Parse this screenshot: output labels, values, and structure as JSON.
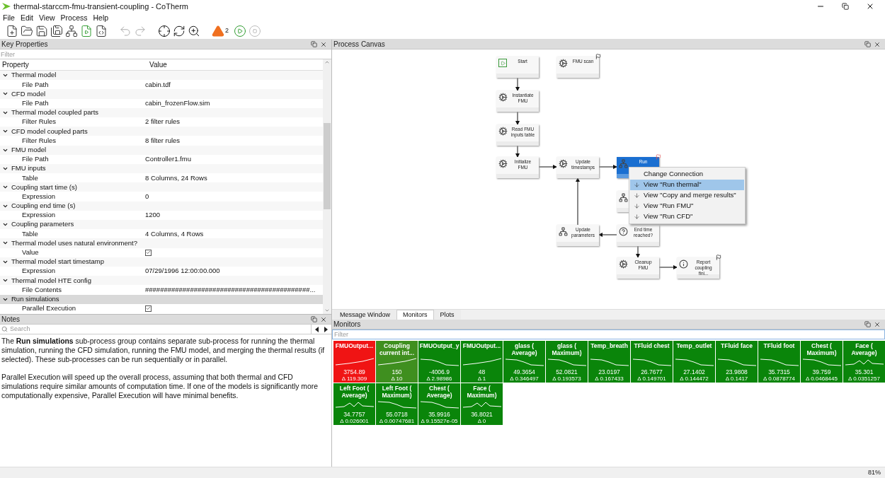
{
  "window": {
    "title": "thermal-starccm-fmu-transient-coupling - CoTherm"
  },
  "menu": [
    "File",
    "Edit",
    "View",
    "Process",
    "Help"
  ],
  "toolbar": {
    "warning_count": "2"
  },
  "key_properties": {
    "title": "Key Properties",
    "filter_placeholder": "Filter",
    "columns": [
      "Property",
      "Value"
    ],
    "groups": [
      {
        "name": "Thermal model",
        "expanded": true,
        "selected": false,
        "children": [
          {
            "name": "File Path",
            "kind": "text",
            "value": "cabin.tdf"
          }
        ]
      },
      {
        "name": "CFD model",
        "expanded": true,
        "selected": false,
        "children": [
          {
            "name": "File Path",
            "kind": "text",
            "value": "cabin_frozenFlow.sim"
          }
        ]
      },
      {
        "name": "Thermal model coupled parts",
        "expanded": true,
        "selected": false,
        "children": [
          {
            "name": "Filter Rules",
            "kind": "text",
            "value": "2 filter rules"
          }
        ]
      },
      {
        "name": "CFD model coupled parts",
        "expanded": true,
        "selected": false,
        "children": [
          {
            "name": "Filter Rules",
            "kind": "text",
            "value": "8 filter rules"
          }
        ]
      },
      {
        "name": "FMU model",
        "expanded": true,
        "selected": false,
        "children": [
          {
            "name": "File Path",
            "kind": "text",
            "value": "Controller1.fmu"
          }
        ]
      },
      {
        "name": "FMU inputs",
        "expanded": true,
        "selected": false,
        "children": [
          {
            "name": "Table",
            "kind": "text",
            "value": "8 Columns, 24 Rows"
          }
        ]
      },
      {
        "name": "Coupling start time (s)",
        "expanded": true,
        "selected": false,
        "children": [
          {
            "name": "Expression",
            "kind": "text",
            "value": "0"
          }
        ]
      },
      {
        "name": "Coupling end time (s)",
        "expanded": true,
        "selected": false,
        "children": [
          {
            "name": "Expression",
            "kind": "text",
            "value": "1200"
          }
        ]
      },
      {
        "name": "Coupling parameters",
        "expanded": true,
        "selected": false,
        "children": [
          {
            "name": "Table",
            "kind": "text",
            "value": "4 Columns, 4 Rows"
          }
        ]
      },
      {
        "name": "Thermal model uses natural environment?",
        "expanded": true,
        "selected": false,
        "children": [
          {
            "name": "Value",
            "kind": "checkbox",
            "checked": true
          }
        ]
      },
      {
        "name": "Thermal model start timestamp",
        "expanded": true,
        "selected": false,
        "children": [
          {
            "name": "Expression",
            "kind": "text",
            "value": "07/29/1996 12:00:00.000"
          }
        ]
      },
      {
        "name": "Thermal model HTE config",
        "expanded": true,
        "selected": false,
        "children": [
          {
            "name": "File Contents",
            "kind": "text",
            "value": "############################################..."
          }
        ]
      },
      {
        "name": "Run simulations",
        "expanded": true,
        "selected": true,
        "children": [
          {
            "name": "Parallel Execution",
            "kind": "checkbox",
            "checked": true
          }
        ]
      }
    ]
  },
  "notes": {
    "title": "Notes",
    "search_placeholder": "Search",
    "paragraphs": [
      "The **Run simulations** sub-process group contains separate sub-process for running the thermal simulation, running the CFD simulation, running the FMU model, and merging the thermal results (if selected). These sub-processes can be run sequentially or in parallel.",
      "Parallel Execution will speed up the overall process, assuming that both thermal and CFD simulations require similar amounts of computation time. If one of the models is significantly more computationally expensive, Parallel Execution will have minimal benefits."
    ]
  },
  "process_canvas": {
    "title": "Process Canvas",
    "nodes": [
      {
        "kind": "start",
        "label": "Start",
        "flag": false,
        "selected": false
      },
      {
        "kind": "task",
        "label": "FMU scan",
        "flag": true,
        "selected": false
      },
      {
        "kind": "task",
        "label": "Instantiate FMU",
        "flag": false,
        "selected": false
      },
      {
        "kind": "task",
        "label": "Read FMU inputs table",
        "flag": false,
        "selected": false
      },
      {
        "kind": "task",
        "label": "Initialize FMU",
        "flag": false,
        "selected": false
      },
      {
        "kind": "task",
        "label": "Update timestamps",
        "flag": false,
        "selected": false
      },
      {
        "kind": "group",
        "label": "Run",
        "flag": true,
        "selected": true
      },
      {
        "kind": "group",
        "flag": false,
        "selected": false
      },
      {
        "kind": "group",
        "label": "Update parameters",
        "flag": false,
        "selected": false
      },
      {
        "kind": "decision",
        "label": "End time reached?",
        "flag": false,
        "selected": false
      },
      {
        "kind": "task",
        "label": "Cleanup FMU",
        "flag": false,
        "selected": false
      },
      {
        "kind": "info",
        "label": "Report coupling fini...",
        "flag": true,
        "selected": false
      }
    ],
    "context_menu": [
      {
        "label": "Change Connection",
        "kind": "plain",
        "selected": false
      },
      {
        "label": "View \"Run thermal\"",
        "kind": "view",
        "selected": true
      },
      {
        "label": "View \"Copy and merge results\"",
        "kind": "view",
        "selected": false
      },
      {
        "label": "View \"Run FMU\"",
        "kind": "view",
        "selected": false
      },
      {
        "label": "View \"Run CFD\"",
        "kind": "view",
        "selected": false
      }
    ]
  },
  "bottom_tabs": [
    {
      "label": "Message Window",
      "selected": false
    },
    {
      "label": "Monitors",
      "selected": true
    },
    {
      "label": "Plots",
      "selected": false
    }
  ],
  "monitors": {
    "title": "Monitors",
    "filter_placeholder": "Filter",
    "tiles": [
      {
        "title": "FMUOutput...",
        "value": "3754.89",
        "delta": "Δ 119.309",
        "color": "#f01414"
      },
      {
        "title": "Coupling current int...",
        "value": "150",
        "delta": "Δ 10",
        "color": "#3f8f1f"
      },
      {
        "title": "FMUOutput_y",
        "value": "-4006.9",
        "delta": "Δ 2.98986",
        "color": "#0a850a"
      },
      {
        "title": "FMUOutput...",
        "value": "48",
        "delta": "Δ 1",
        "color": "#0a850a"
      },
      {
        "title": "glass ( Average)",
        "value": "49.3654",
        "delta": "Δ 0.346497",
        "color": "#0a850a"
      },
      {
        "title": "glass ( Maximum)",
        "value": "52.0821",
        "delta": "Δ 0.193573",
        "color": "#0a850a"
      },
      {
        "title": "Temp_breath",
        "value": "23.0197",
        "delta": "Δ 0.167433",
        "color": "#0a850a"
      },
      {
        "title": "TFluid chest",
        "value": "26.7677",
        "delta": "Δ 0.149701",
        "color": "#0a850a"
      },
      {
        "title": "Temp_outlet",
        "value": "27.1402",
        "delta": "Δ 0.144472",
        "color": "#0a850a"
      },
      {
        "title": "TFluid face",
        "value": "23.9808",
        "delta": "Δ 0.1417",
        "color": "#0a850a"
      },
      {
        "title": "TFluid foot",
        "value": "35.7315",
        "delta": "Δ 0.0878774",
        "color": "#0a850a"
      },
      {
        "title": "Chest ( Maximum)",
        "value": "39.759",
        "delta": "Δ 0.0468445",
        "color": "#0a850a"
      },
      {
        "title": "Face ( Average)",
        "value": "35.301",
        "delta": "Δ 0.0351257",
        "color": "#0a850a"
      },
      {
        "title": "Left Foot ( Average)",
        "value": "34.7757",
        "delta": "Δ 0.026001",
        "color": "#0a850a"
      },
      {
        "title": "Left Foot ( Maximum)",
        "value": "55.0718",
        "delta": "Δ 0.00747681",
        "color": "#0a850a"
      },
      {
        "title": "Chest ( Average)",
        "value": "35.9916",
        "delta": "Δ 9.15527e-05",
        "color": "#0a850a"
      },
      {
        "title": "Face ( Maximum)",
        "value": "36.8021",
        "delta": "Δ 0",
        "color": "#0a850a"
      }
    ]
  },
  "status_bar": {
    "zoom": "81%"
  }
}
